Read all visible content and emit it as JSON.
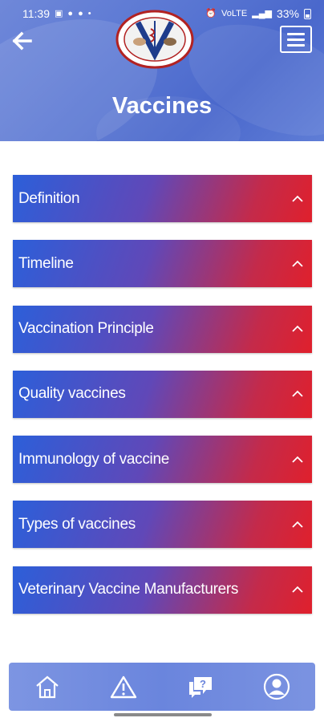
{
  "status_bar": {
    "time": "11:39",
    "battery": "33%",
    "signal_labels": "VoLTE"
  },
  "header": {
    "title": "Vaccines",
    "logo_icon": "veterinary-council-logo",
    "back_icon": "arrow-left-icon",
    "menu_icon": "hamburger-menu-icon"
  },
  "accordion": {
    "items": [
      {
        "label": "Definition"
      },
      {
        "label": "Timeline"
      },
      {
        "label": "Vaccination Principle"
      },
      {
        "label": "Quality vaccines"
      },
      {
        "label": "Immunology of vaccine"
      },
      {
        "label": "Types of vaccines"
      },
      {
        "label": "Veterinary Vaccine Manufacturers"
      }
    ]
  },
  "bottom_nav": {
    "items": [
      "home-icon",
      "warning-icon",
      "help-chat-icon",
      "profile-icon"
    ]
  },
  "colors": {
    "header_blue": "#5a77d3",
    "gradient_blue": "#2c5fd9",
    "gradient_red": "#e0202c",
    "nav_blue": "#6a85dd"
  }
}
